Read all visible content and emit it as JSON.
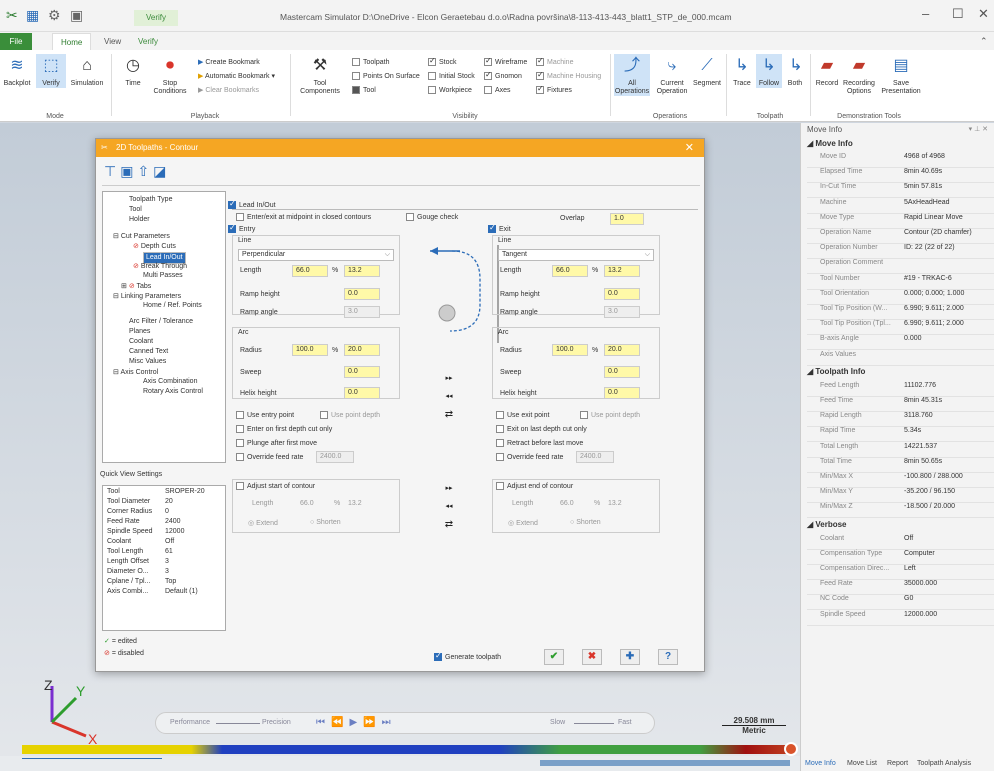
{
  "window": {
    "app_title": "Mastercam Simulator  D:\\OneDrive - Elcon Geraetebau d.o.o\\Radna površina\\8-113-413-443_blatt1_STP_de_000.mcam",
    "context_tab": "Verify",
    "min": "–",
    "max": "☐",
    "close": "✕"
  },
  "ribbon": {
    "tabs": [
      "File",
      "Home",
      "View",
      "Verify"
    ],
    "mode": {
      "label": "Mode",
      "buttons": [
        "Backplot",
        "Verify",
        "Simulation"
      ]
    },
    "playback": {
      "label": "Playback",
      "time": "Time",
      "stop": "Stop Conditions",
      "create_bookmark": "Create Bookmark",
      "auto_bookmark": "Automatic Bookmark",
      "clear_bookmarks": "Clear Bookmarks"
    },
    "visibility": {
      "label": "Visibility",
      "tool_components": "Tool Components",
      "items": [
        "Toolpath",
        "Points On Surface",
        "Tool",
        "Stock",
        "Initial Stock",
        "Workpiece",
        "Wireframe",
        "Gnomon",
        "Axes",
        "Machine",
        "Machine Housing",
        "Fixtures"
      ]
    },
    "operations": {
      "label": "Operations",
      "buttons": [
        "All Operations",
        "Current Operation",
        "Segment"
      ]
    },
    "toolpath": {
      "label": "Toolpath",
      "buttons": [
        "Trace",
        "Follow",
        "Both"
      ]
    },
    "demo": {
      "label": "Demonstration Tools",
      "buttons": [
        "Record",
        "Recording Options",
        "Save Presentation"
      ]
    }
  },
  "dialog": {
    "title": "2D Toolpaths - Contour",
    "close": "✕",
    "tree": [
      "Toolpath Type",
      "Tool",
      "Holder",
      "Cut Parameters",
      "Depth Cuts",
      "Lead In/Out",
      "Break Through",
      "Multi Passes",
      "Tabs",
      "Linking Parameters",
      "Home / Ref. Points",
      "Arc Filter / Tolerance",
      "Planes",
      "Coolant",
      "Canned Text",
      "Misc Values",
      "Axis Control",
      "Axis Combination",
      "Rotary Axis Control"
    ],
    "quick_view_title": "Quick View Settings",
    "quick_view": [
      {
        "k": "Tool",
        "v": "SROPER-20"
      },
      {
        "k": "Tool Diameter",
        "v": "20"
      },
      {
        "k": "Corner Radius",
        "v": "0"
      },
      {
        "k": "Feed Rate",
        "v": "2400"
      },
      {
        "k": "Spindle Speed",
        "v": "12000"
      },
      {
        "k": "Coolant",
        "v": "Off"
      },
      {
        "k": "Tool Length",
        "v": "61"
      },
      {
        "k": "Length Offset",
        "v": "3"
      },
      {
        "k": "Diameter O...",
        "v": "3"
      },
      {
        "k": "Cplane / Tpl...",
        "v": "Top"
      },
      {
        "k": "Axis Combi...",
        "v": "Default (1)"
      }
    ],
    "legend_edited": "= edited",
    "legend_disabled": "= disabled",
    "lead_in_out": "Lead In/Out",
    "enter_exit_midpoint": "Enter/exit at midpoint in closed contours",
    "gouge_check": "Gouge check",
    "overlap_label": "Overlap",
    "overlap_value": "1.0",
    "entry": {
      "title": "Entry",
      "line": "Line",
      "line_type": "Perpendicular",
      "length_label": "Length",
      "length": "66.0",
      "pct": "%",
      "length_pct": "13.2",
      "ramp_height_label": "Ramp height",
      "ramp_height": "0.0",
      "ramp_angle_label": "Ramp angle",
      "ramp_angle": "3.0",
      "arc": "Arc",
      "radius_label": "Radius",
      "radius": "100.0",
      "radius_pct": "20.0",
      "sweep_label": "Sweep",
      "sweep": "0.0",
      "helix_label": "Helix height",
      "helix": "0.0",
      "use_point": "Use entry point",
      "use_point_depth": "Use point depth",
      "first_depth": "Enter on first depth cut only",
      "plunge": "Plunge after first move",
      "override_feed": "Override feed rate",
      "override_value": "2400.0",
      "adjust": "Adjust start of contour",
      "adj_length": "66.0",
      "adj_pct": "13.2",
      "extend": "Extend",
      "shorten": "Shorten"
    },
    "exit": {
      "title": "Exit",
      "line": "Line",
      "line_type": "Tangent",
      "length_label": "Length",
      "length": "66.0",
      "pct": "%",
      "length_pct": "13.2",
      "ramp_height_label": "Ramp height",
      "ramp_height": "0.0",
      "ramp_angle_label": "Ramp angle",
      "ramp_angle": "3.0",
      "arc": "Arc",
      "radius_label": "Radius",
      "radius": "100.0",
      "radius_pct": "20.0",
      "sweep_label": "Sweep",
      "sweep": "0.0",
      "helix_label": "Helix height",
      "helix": "0.0",
      "use_point": "Use exit point",
      "use_point_depth": "Use point depth",
      "first_depth": "Exit on last depth cut only",
      "plunge": "Retract before last move",
      "override_feed": "Override feed rate",
      "override_value": "2400.0",
      "adjust": "Adjust end of contour",
      "adj_length": "66.0",
      "adj_pct": "13.2",
      "extend": "Extend",
      "shorten": "Shorten"
    },
    "generate_toolpath": "Generate toolpath"
  },
  "move_info": {
    "title": "Move Info",
    "section_move": "Move Info",
    "rows": [
      {
        "k": "Move ID",
        "v": "4968 of 4968"
      },
      {
        "k": "Elapsed Time",
        "v": "8min 40.69s"
      },
      {
        "k": "In-Cut Time",
        "v": "5min 57.81s"
      },
      {
        "k": "Machine",
        "v": "5AxHeadHead"
      },
      {
        "k": "Move Type",
        "v": "Rapid Linear Move"
      },
      {
        "k": "Operation Name",
        "v": "Contour (2D chamfer)"
      },
      {
        "k": "Operation Number",
        "v": "ID: 22 (22 of 22)"
      },
      {
        "k": "Operation Comment",
        "v": ""
      },
      {
        "k": "Tool Number",
        "v": "#19 - TRKAC-6"
      },
      {
        "k": "Tool Orientation",
        "v": "0.000; 0.000; 1.000"
      },
      {
        "k": "Tool Tip Position (W...",
        "v": "6.990; 9.611; 2.000"
      },
      {
        "k": "Tool Tip Position (Tpl...",
        "v": "6.990; 9.611; 2.000"
      },
      {
        "k": "B-axis Angle",
        "v": "0.000"
      },
      {
        "k": "Axis Values",
        "v": ""
      }
    ],
    "section_toolpath": "Toolpath Info",
    "toolpath_rows": [
      {
        "k": "Feed Length",
        "v": "11102.776"
      },
      {
        "k": "Feed Time",
        "v": "8min 45.31s"
      },
      {
        "k": "Rapid Length",
        "v": "3118.760"
      },
      {
        "k": "Rapid Time",
        "v": "5.34s"
      },
      {
        "k": "Total Length",
        "v": "14221.537"
      },
      {
        "k": "Total Time",
        "v": "8min 50.65s"
      },
      {
        "k": "Min/Max X",
        "v": "-100.800 / 288.000"
      },
      {
        "k": "Min/Max Y",
        "v": "-35.200 / 96.150"
      },
      {
        "k": "Min/Max Z",
        "v": "-18.500 / 20.000"
      }
    ],
    "section_verbose": "Verbose",
    "verbose_rows": [
      {
        "k": "Coolant",
        "v": "Off"
      },
      {
        "k": "Compensation Type",
        "v": "Computer"
      },
      {
        "k": "Compensation Direc...",
        "v": "Left"
      },
      {
        "k": "Feed Rate",
        "v": "35000.000"
      },
      {
        "k": "NC Code",
        "v": "G0"
      },
      {
        "k": "Spindle Speed",
        "v": "12000.000"
      }
    ],
    "tabs": [
      "Move Info",
      "Move List",
      "Report",
      "Toolpath Analysis"
    ]
  },
  "playbar": {
    "performance": "Performance",
    "precision": "Precision",
    "slow": "Slow",
    "fast": "Fast"
  },
  "scale": {
    "value": "29.508 mm",
    "unit": "Metric"
  }
}
